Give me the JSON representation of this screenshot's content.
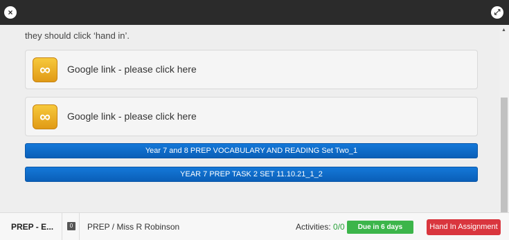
{
  "window": {
    "close_glyph": "×",
    "expand_glyph": "⤢"
  },
  "content": {
    "intro_text": "they should click ‘hand in’.",
    "links": [
      {
        "icon": "link-icon",
        "label": "Google link - please click here"
      },
      {
        "icon": "link-icon",
        "label": "Google link - please click here"
      }
    ],
    "resources": [
      {
        "label": "Year 7 and 8 PREP VOCABULARY AND READING Set Two_1"
      },
      {
        "label": "YEAR 7 PREP TASK 2 SET 11.10.21_1_2"
      }
    ]
  },
  "footer": {
    "assignment_title": "PREP - E...",
    "comment_count": "0",
    "teacher": "PREP / Miss R Robinson",
    "activities_label": "Activities: ",
    "activities_value": "0/0",
    "due": "Due in 6 days",
    "hand_in_label": "Hand In Assignment"
  },
  "colors": {
    "resource_button": "#0a6fd0",
    "due_badge": "#3cb54a",
    "hand_in": "#d9363e",
    "title_bar": "#2b2b2b"
  }
}
